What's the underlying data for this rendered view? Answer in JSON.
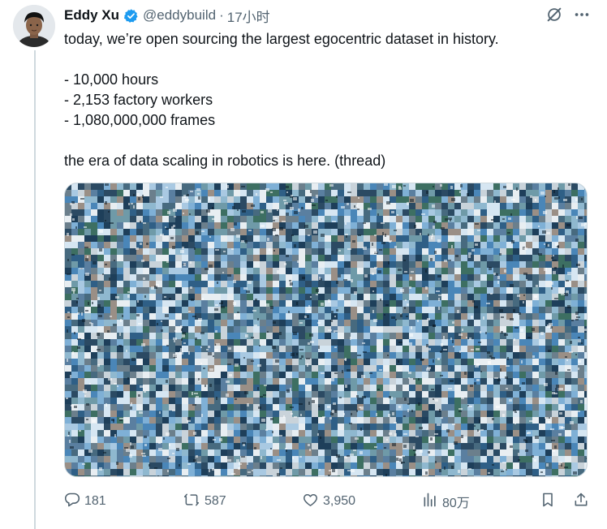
{
  "author": {
    "name": "Eddy Xu",
    "handle": "@eddybuild",
    "separator": "·",
    "time": "17小时"
  },
  "icons": {
    "verified": "verified-badge-icon",
    "grok": "grok-icon",
    "more": "more-icon",
    "reply": "reply-icon",
    "repost": "repost-icon",
    "like": "like-icon",
    "views": "views-icon",
    "bookmark": "bookmark-icon",
    "share": "share-icon"
  },
  "colors": {
    "verified": "#1d9bf0",
    "text": "#0f1419",
    "secondary": "#536471"
  },
  "tweet": {
    "lines": [
      "today, we’re open sourcing the largest egocentric dataset in history.",
      "",
      "- 10,000 hours",
      "- 2,153 factory workers",
      "- 1,080,000,000 frames",
      "",
      "the era of data scaling in robotics is here. (thread)"
    ]
  },
  "stats": {
    "replies": "181",
    "reposts": "587",
    "likes": "3,950",
    "views": "80万"
  }
}
